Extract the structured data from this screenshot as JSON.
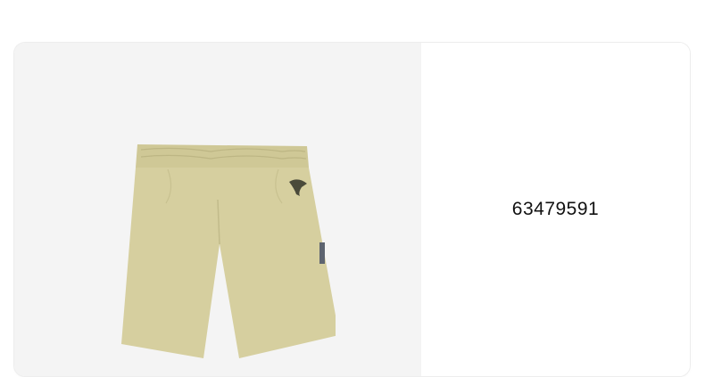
{
  "product": {
    "id_label": "63479591",
    "image_alt": "Beige shorts",
    "colors": {
      "fabric": "#d6cf9f",
      "fabric_shadow": "#c2bb8b",
      "logo": "#4a4a3a",
      "tag": "#5d6470"
    }
  }
}
